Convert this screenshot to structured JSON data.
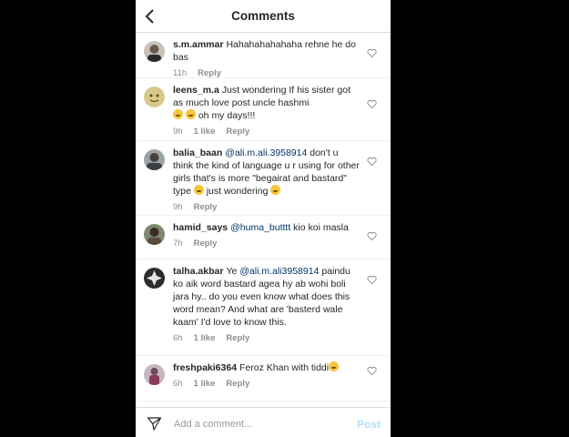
{
  "header": {
    "title": "Comments"
  },
  "comments": [
    {
      "username": "s.m.ammar",
      "text": "Hahahahahahaha rehne he do bas",
      "time": "11h",
      "reply": "Reply"
    },
    {
      "username": "leens_m.a",
      "text": "Just wondering If his sister got as much love post uncle hashmi",
      "emoji_text": "oh my days!!!",
      "time": "9h",
      "likes": "1 like",
      "reply": "Reply"
    },
    {
      "username": "balia_baan",
      "mention": "@ali.m.ali.3958914",
      "text": "don't u think the kind of language u r using for other girls that's is more \"begairat and bastard\" type",
      "emoji_text": "just wondering",
      "time": "9h",
      "reply": "Reply"
    },
    {
      "username": "hamid_says",
      "mention": "@huma_butttt",
      "text": "kio koi masla",
      "time": "7h",
      "reply": "Reply"
    },
    {
      "username": "talha.akbar",
      "pre": "Ye",
      "mention": "@ali.m.ali3958914",
      "text": "paindu ko aik word bastard agea hy ab wohi boli jara hy.. do you even know what does this word mean? And what are 'basterd wale kaam' I'd love to know this.",
      "time": "6h",
      "likes": "1 like",
      "reply": "Reply"
    },
    {
      "username": "freshpaki6364",
      "text": "Feroz Khan with tiddi",
      "time": "6h",
      "likes": "1 like",
      "reply": "Reply"
    }
  ],
  "footer": {
    "placeholder": "Add a comment...",
    "post_label": "Post"
  },
  "colors": {
    "accent_disabled": "#b2dffc",
    "mention": "#003569",
    "meta": "#8e8e8e"
  }
}
